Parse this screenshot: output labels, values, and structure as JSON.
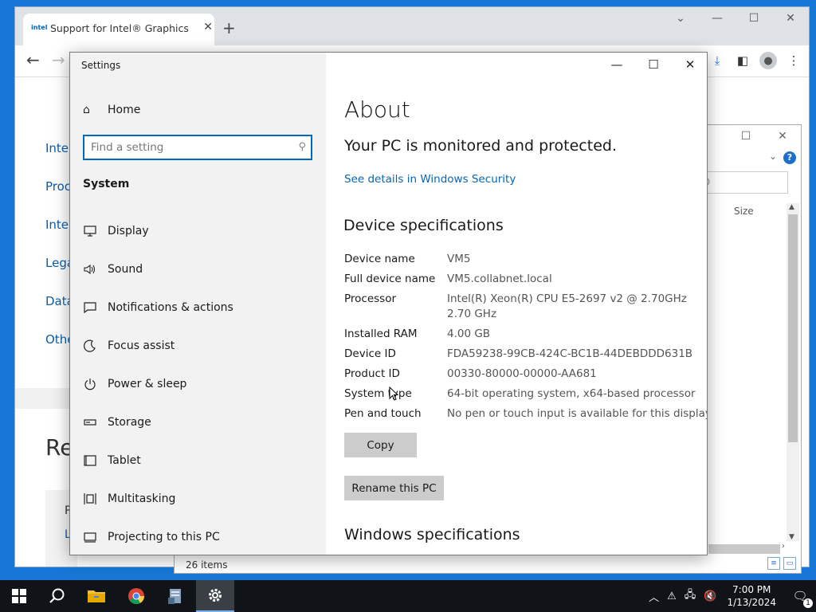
{
  "browser": {
    "tab_favicon": "intel",
    "tab_title": "Support for Intel® Graphics",
    "tab_close": "✕",
    "new_tab": "+",
    "page_links": [
      "Intel",
      "Proc",
      "Intel",
      "Lega",
      "Data",
      "Othe"
    ],
    "page_heading": "Re",
    "page_card_text": "P",
    "page_card_link": "L"
  },
  "explorer": {
    "search_placeholder": "0",
    "column_size": "Size",
    "help": "?",
    "status": "26 items"
  },
  "settings": {
    "app_title": "Settings",
    "home_label": "Home",
    "search_placeholder": "Find a setting",
    "group_label": "System",
    "nav_items": [
      {
        "label": "Display",
        "icon": "display-icon"
      },
      {
        "label": "Sound",
        "icon": "sound-icon"
      },
      {
        "label": "Notifications & actions",
        "icon": "notifications-icon"
      },
      {
        "label": "Focus assist",
        "icon": "focus-assist-icon"
      },
      {
        "label": "Power & sleep",
        "icon": "power-icon"
      },
      {
        "label": "Storage",
        "icon": "storage-icon"
      },
      {
        "label": "Tablet",
        "icon": "tablet-icon"
      },
      {
        "label": "Multitasking",
        "icon": "multitasking-icon"
      },
      {
        "label": "Projecting to this PC",
        "icon": "projecting-icon"
      }
    ],
    "about_title": "About",
    "protection_status": "Your PC is monitored and protected.",
    "security_link": "See details in Windows Security",
    "device_spec_title": "Device specifications",
    "device_specs": [
      {
        "key": "Device name",
        "value": "VM5"
      },
      {
        "key": "Full device name",
        "value": "VM5.collabnet.local"
      },
      {
        "key": "Processor",
        "value": "Intel(R) Xeon(R) CPU E5-2697 v2 @ 2.70GHz\n2.70 GHz"
      },
      {
        "key": "Installed RAM",
        "value": "4.00 GB"
      },
      {
        "key": "Device ID",
        "value": "FDA59238-99CB-424C-BC1B-44DEBDDD631B"
      },
      {
        "key": "Product ID",
        "value": "00330-80000-00000-AA681"
      },
      {
        "key": "System type",
        "value": "64-bit operating system, x64-based processor"
      },
      {
        "key": "Pen and touch",
        "value": "No pen or touch input is available for this display"
      }
    ],
    "copy_button": "Copy",
    "rename_button": "Rename this PC",
    "windows_spec_title": "Windows specifications"
  },
  "taskbar": {
    "time": "7:00 PM",
    "date": "1/13/2024",
    "notification_count": "1",
    "pinned": [
      "search-icon",
      "file-explorer-icon",
      "chrome-icon",
      "server-manager-icon",
      "settings-icon"
    ]
  },
  "colors": {
    "accent": "#0067c0",
    "link": "#0a64b3",
    "taskbar": "#101418",
    "desktop": "#1677d6"
  }
}
